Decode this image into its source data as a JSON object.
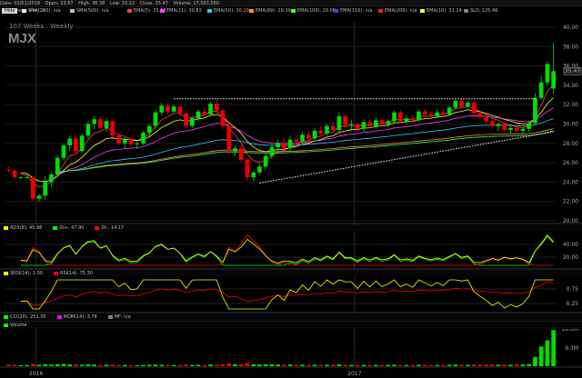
{
  "toolbar": {
    "date": "Date: 01/01/2018",
    "open": "Open: 33.67",
    "high": "High: 38.38",
    "low": "Low: 33.12",
    "close": "Close: 35.47",
    "volume": "Volume: 17,563,560"
  },
  "hide_label": "Hide",
  "trendline_label": "Trend line (2)",
  "period_label": "107 Weeks : Weekly",
  "symbol": "MJX",
  "legend": [
    {
      "label": "SMA(200): n/a",
      "color": "#ffffff"
    },
    {
      "label": "SMA(500): n/a",
      "color": "#c0c0c0"
    },
    {
      "label": "EMA(5): 33.12",
      "color": "#ff4040"
    },
    {
      "label": "EMA(21): 30.83",
      "color": "#ff40ff"
    },
    {
      "label": "EMA(50): 30.10",
      "color": "#40c0ff"
    },
    {
      "label": "EMA(89): 29.39",
      "color": "#ff9040"
    },
    {
      "label": "EMA(100): 29.00",
      "color": "#40ff40"
    },
    {
      "label": "EMA(150): n/a",
      "color": "#4040ff"
    },
    {
      "label": "EMA(200): n/a",
      "color": "#ff2020"
    },
    {
      "label": "EMA(10): 31.24",
      "color": "#ffff40"
    },
    {
      "label": "SLO: 125.46",
      "color": "#808080"
    }
  ],
  "panes": {
    "adx": [
      {
        "label": "ADX(8): 45.98",
        "color": "#ffff00"
      },
      {
        "label": "DI+: 47.90",
        "color": "#00ff00"
      },
      {
        "label": "DI-: 14.17",
        "color": "#ff0000"
      }
    ],
    "srsi": [
      {
        "label": "SRSI(14): 1.00",
        "color": "#ffff00"
      },
      {
        "label": "RSI(14): 75.30",
        "color": "#ff0000"
      }
    ],
    "cci": [
      {
        "label": "CCI(20): 252.35",
        "color": "#00ff00"
      },
      {
        "label": "MOM(14): 3.78",
        "color": "#ff00ff"
      },
      {
        "label": "MF: n/a",
        "color": "#808080"
      }
    ],
    "volume": [
      {
        "label": "Volume",
        "color": "#00ff00"
      }
    ]
  },
  "price_axis": [
    "40.00",
    "38.00",
    "36.00",
    "34.00",
    "32.00",
    "30.00",
    "28.00",
    "26.00",
    "24.00",
    "22.00",
    "20.00"
  ],
  "last_price_tag": "35.47",
  "adx_axis": [
    "40.00",
    "20.00"
  ],
  "srsi_axis": [
    "0.75",
    "0.25"
  ],
  "volume_axis": [
    "18.6M",
    "9.3M"
  ],
  "x_axis": [
    "2016",
    "2017"
  ],
  "colors": {
    "up": "#00dd00",
    "down": "#ee0000",
    "background": "#000000",
    "grid": "#1a1a1a"
  },
  "chart_data": {
    "type": "candlestick",
    "ylim": [
      20,
      40
    ],
    "candles": [
      [
        25.3,
        25.6,
        25.0,
        25.2
      ],
      [
        25.2,
        25.3,
        24.4,
        24.5
      ],
      [
        24.5,
        24.6,
        24.4,
        24.5
      ],
      [
        24.5,
        24.6,
        24.4,
        24.5
      ],
      [
        24.5,
        24.5,
        22.0,
        22.3
      ],
      [
        22.3,
        22.8,
        22.0,
        22.6
      ],
      [
        22.6,
        24.6,
        22.2,
        24.0
      ],
      [
        24.0,
        25.0,
        23.5,
        24.8
      ],
      [
        24.8,
        26.8,
        24.5,
        26.5
      ],
      [
        26.5,
        28.0,
        26.2,
        27.8
      ],
      [
        27.8,
        28.8,
        27.2,
        28.5
      ],
      [
        28.5,
        28.8,
        27.0,
        27.2
      ],
      [
        27.2,
        29.0,
        27.0,
        28.8
      ],
      [
        28.8,
        30.3,
        28.5,
        30.0
      ],
      [
        30.0,
        30.8,
        29.5,
        30.5
      ],
      [
        30.5,
        30.8,
        29.5,
        29.6
      ],
      [
        29.6,
        30.5,
        29.2,
        30.3
      ],
      [
        30.3,
        30.4,
        28.6,
        28.8
      ],
      [
        28.8,
        29.0,
        27.8,
        28.0
      ],
      [
        28.0,
        28.6,
        27.5,
        28.4
      ],
      [
        28.4,
        28.5,
        27.6,
        27.9
      ],
      [
        27.9,
        28.2,
        27.4,
        28.0
      ],
      [
        28.0,
        29.3,
        27.8,
        29.1
      ],
      [
        29.1,
        30.0,
        28.8,
        29.8
      ],
      [
        29.8,
        31.5,
        29.5,
        31.2
      ],
      [
        31.2,
        32.2,
        30.9,
        31.9
      ],
      [
        31.9,
        32.1,
        31.0,
        31.3
      ],
      [
        31.3,
        32.0,
        31.1,
        31.8
      ],
      [
        31.8,
        31.9,
        30.9,
        31.1
      ],
      [
        31.1,
        31.4,
        29.6,
        29.8
      ],
      [
        29.8,
        30.8,
        29.6,
        30.6
      ],
      [
        30.6,
        31.5,
        30.3,
        31.3
      ],
      [
        31.3,
        31.8,
        30.9,
        31.0
      ],
      [
        31.0,
        32.3,
        30.8,
        32.1
      ],
      [
        32.1,
        32.6,
        31.0,
        31.4
      ],
      [
        31.4,
        31.6,
        29.5,
        29.8
      ],
      [
        29.8,
        30.1,
        26.8,
        27.2
      ],
      [
        27.2,
        27.8,
        26.7,
        27.5
      ],
      [
        27.5,
        27.9,
        26.0,
        26.3
      ],
      [
        26.3,
        26.6,
        24.1,
        24.5
      ],
      [
        24.5,
        25.2,
        24.1,
        25.0
      ],
      [
        25.0,
        25.9,
        24.8,
        25.6
      ],
      [
        25.6,
        27.0,
        25.4,
        26.7
      ],
      [
        26.7,
        27.9,
        26.4,
        27.6
      ],
      [
        27.6,
        28.4,
        27.2,
        28.0
      ],
      [
        28.0,
        28.6,
        27.3,
        27.5
      ],
      [
        27.5,
        28.8,
        27.2,
        28.4
      ],
      [
        28.4,
        28.9,
        27.8,
        28.2
      ],
      [
        28.2,
        29.2,
        28.0,
        28.9
      ],
      [
        28.9,
        29.3,
        28.2,
        28.5
      ],
      [
        28.5,
        29.6,
        28.2,
        29.3
      ],
      [
        29.3,
        29.8,
        28.7,
        29.0
      ],
      [
        29.0,
        30.0,
        28.8,
        29.8
      ],
      [
        29.8,
        30.2,
        29.0,
        29.4
      ],
      [
        29.4,
        31.2,
        29.2,
        30.8
      ],
      [
        30.8,
        31.0,
        29.5,
        29.9
      ],
      [
        29.9,
        30.4,
        29.3,
        30.0
      ],
      [
        30.0,
        30.2,
        29.2,
        29.5
      ],
      [
        29.5,
        30.5,
        29.2,
        30.2
      ],
      [
        30.2,
        30.5,
        29.6,
        29.8
      ],
      [
        29.8,
        30.7,
        29.5,
        30.4
      ],
      [
        30.4,
        30.6,
        29.8,
        30.0
      ],
      [
        30.0,
        30.5,
        29.7,
        30.3
      ],
      [
        30.3,
        31.4,
        30.0,
        31.2
      ],
      [
        31.2,
        31.4,
        30.1,
        30.3
      ],
      [
        30.3,
        30.9,
        30.0,
        30.6
      ],
      [
        30.6,
        31.0,
        30.2,
        30.4
      ],
      [
        30.4,
        31.5,
        30.2,
        31.3
      ],
      [
        31.3,
        31.6,
        30.8,
        31.0
      ],
      [
        31.0,
        31.3,
        30.6,
        30.8
      ],
      [
        30.8,
        31.5,
        30.6,
        31.2
      ],
      [
        31.2,
        31.6,
        30.9,
        31.0
      ],
      [
        31.0,
        31.9,
        30.8,
        31.7
      ],
      [
        31.7,
        32.6,
        31.5,
        32.4
      ],
      [
        32.4,
        32.6,
        31.6,
        31.8
      ],
      [
        31.8,
        32.4,
        31.6,
        32.2
      ],
      [
        32.2,
        32.3,
        30.9,
        31.1
      ],
      [
        31.1,
        31.4,
        30.5,
        30.7
      ],
      [
        30.7,
        31.0,
        30.0,
        30.3
      ],
      [
        30.3,
        30.5,
        29.5,
        29.8
      ],
      [
        29.8,
        30.2,
        29.3,
        30.0
      ],
      [
        30.0,
        30.1,
        29.2,
        29.4
      ],
      [
        29.4,
        29.8,
        29.0,
        29.6
      ],
      [
        29.6,
        30.0,
        29.1,
        29.3
      ],
      [
        29.3,
        29.7,
        28.9,
        29.5
      ],
      [
        29.5,
        30.3,
        29.2,
        30.1
      ],
      [
        30.1,
        33.2,
        30.0,
        32.7
      ],
      [
        32.7,
        35.0,
        32.5,
        34.3
      ],
      [
        34.3,
        36.5,
        34.0,
        36.2
      ],
      [
        33.67,
        38.38,
        33.12,
        35.47
      ]
    ],
    "resistance": 32.6,
    "support": [
      [
        41,
        23.9
      ],
      [
        89,
        29.2
      ]
    ],
    "volume": [
      0.8,
      0.7,
      0.5,
      0.6,
      1.2,
      0.7,
      0.9,
      0.8,
      1.0,
      1.1,
      0.9,
      0.8,
      0.7,
      0.9,
      0.8,
      0.6,
      0.7,
      0.8,
      0.6,
      0.6,
      0.5,
      0.5,
      0.6,
      0.7,
      0.8,
      0.7,
      0.6,
      0.6,
      0.6,
      0.8,
      0.6,
      0.7,
      0.6,
      0.8,
      0.7,
      0.9,
      1.3,
      0.9,
      1.0,
      1.6,
      0.9,
      0.8,
      0.9,
      0.9,
      0.8,
      0.7,
      0.8,
      0.7,
      0.7,
      0.6,
      0.7,
      0.6,
      0.7,
      0.7,
      0.9,
      0.7,
      0.6,
      0.6,
      0.6,
      0.6,
      0.6,
      0.6,
      0.6,
      0.7,
      0.6,
      0.6,
      0.6,
      0.7,
      0.6,
      0.6,
      0.6,
      0.6,
      0.7,
      0.8,
      0.7,
      0.7,
      0.8,
      0.7,
      0.7,
      0.8,
      0.7,
      0.8,
      0.7,
      0.8,
      0.8,
      1.0,
      4.5,
      9.6,
      12.6,
      17.6
    ]
  }
}
